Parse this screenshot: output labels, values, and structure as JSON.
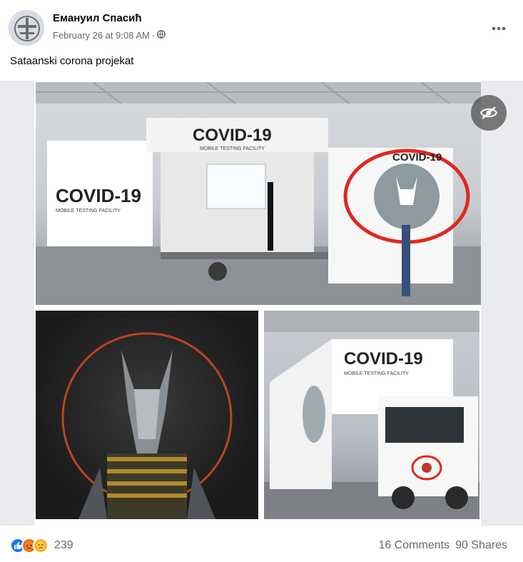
{
  "post": {
    "author": "Емануил Спасић",
    "timestamp": "February 26 at 9:08 AM",
    "separator": "·",
    "privacy_icon": "globe-icon",
    "text": "Sataanski corona projekat"
  },
  "media": {
    "sign_main": "COVID-19",
    "sign_sub": "MOBILE TESTING FACILITY",
    "hide_icon": "eye-slash-icon"
  },
  "footer": {
    "reaction_icons": [
      "like-icon",
      "angry-icon",
      "sad-icon"
    ],
    "reaction_count": "239",
    "comments": "16 Comments",
    "shares": "90 Shares"
  },
  "colors": {
    "accent": "#1877f2",
    "secondary_text": "#65676b",
    "circle_red": "#e0281e"
  }
}
